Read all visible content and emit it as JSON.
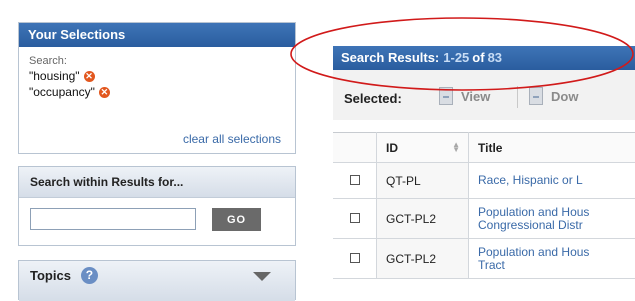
{
  "selections": {
    "header": "Your Selections",
    "search_label": "Search:",
    "terms": [
      "\"housing\"",
      "\"occupancy\""
    ],
    "clear_link": "clear all selections"
  },
  "search_within": {
    "header": "Search within Results for...",
    "input_value": "",
    "go_label": "GO"
  },
  "topics": {
    "header": "Topics",
    "help_glyph": "?"
  },
  "results": {
    "label": "Search Results:",
    "range": "1-25",
    "of": "of",
    "total": "83"
  },
  "toolbar": {
    "selected_label": "Selected:",
    "view_label": "View",
    "download_label": "Dow"
  },
  "table": {
    "headers": {
      "id": "ID",
      "title": "Title"
    },
    "rows": [
      {
        "id": "QT-PL",
        "title_lines": [
          "Race, Hispanic or L"
        ]
      },
      {
        "id": "GCT-PL2",
        "title_lines": [
          "Population and Hous",
          "Congressional Distr"
        ]
      },
      {
        "id": "GCT-PL2",
        "title_lines": [
          "Population and Hous",
          "Tract"
        ]
      }
    ]
  },
  "colors": {
    "header_blue": "#2f63a6",
    "annotation_red": "#d11a1a",
    "remove_orange": "#e2571e",
    "link_blue": "#3a6aa8"
  }
}
